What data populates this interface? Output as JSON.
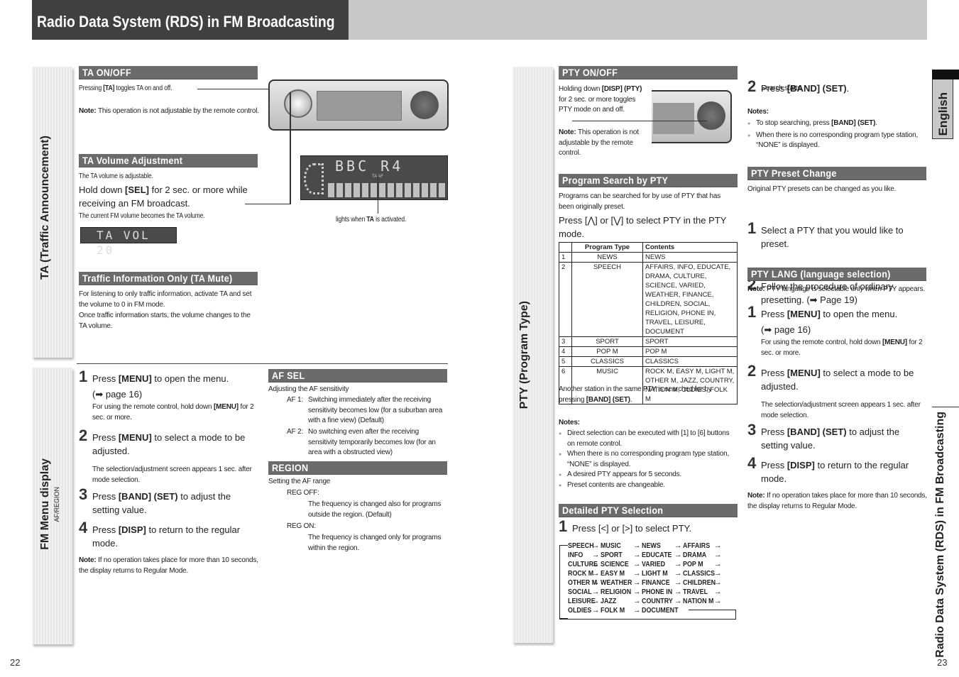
{
  "header": {
    "title": "Radio Data System (RDS) in FM Broadcasting"
  },
  "left_page": {
    "page_number": "22",
    "side_tabs": {
      "ta": "TA (Traffic Announcement)",
      "fm_menu": "FM Menu display",
      "fm_menu_sub": "AF/REGION"
    },
    "ta_on_off": {
      "heading": "TA ON/OFF",
      "text_pre": "Pressing ",
      "text_key": "[TA]",
      "text_post": " toggles TA on and off.",
      "note_label": "Note:",
      "note_text": " This operation is not adjustable by the remote control."
    },
    "ta_volume": {
      "heading": "TA Volume Adjustment",
      "intro": "The TA volume is adjustable.",
      "instr_pre": "Hold down ",
      "instr_key": "[SEL]",
      "instr_post": " for 2 sec. or more while receiving an FM broadcast.",
      "result": "The current FM volume becomes the TA volume.",
      "lcd_text": "TA VOL 20"
    },
    "display_illustration": {
      "lcd_station": "BBC R4",
      "indicators": "TA  AF",
      "caption_pre": "lights when ",
      "caption_key": "TA",
      "caption_post": " is activated."
    },
    "ta_mute": {
      "heading": "Traffic Information Only (TA Mute)",
      "p1": "For listening to only traffic information, activate TA and set the volume to 0 in FM mode.",
      "p2": "Once traffic information starts, the volume changes to the TA volume."
    },
    "fm_menu_steps": {
      "s1_num": "1",
      "s1_pre": "Press ",
      "s1_key": "[MENU]",
      "s1_post": " to open the menu.",
      "s1_ref": "(➡ page 16)",
      "s1_note_pre": "For using the remote control, hold down ",
      "s1_note_key": "[MENU]",
      "s1_note_post": " for 2 sec. or more.",
      "s2_num": "2",
      "s2_pre": "Press ",
      "s2_key": "[MENU]",
      "s2_post": " to select a mode to be adjusted.",
      "s2_note": "The selection/adjustment screen appears 1 sec. after mode selection.",
      "s3_num": "3",
      "s3_pre": "Press ",
      "s3_key": "[BAND] (SET)",
      "s3_post": " to adjust the setting value.",
      "s4_num": "4",
      "s4_pre": "Press ",
      "s4_key": "[DISP]",
      "s4_post": " to return to the regular mode.",
      "note_label": "Note:",
      "note_text": " If no operation takes place for more than 10 seconds, the display returns to Regular Mode."
    },
    "af_sel": {
      "heading": "AF SEL",
      "intro": "Adjusting the AF sensitivity",
      "af1_label": "AF 1:",
      "af1_text": "Switching immediately after the receiving sensitivity becomes low (for a suburban area with a fine view) (Default)",
      "af2_label": "AF 2:",
      "af2_text": "No switching even after the receiving sensitivity temporarily becomes low (for an area with a obstructed view)"
    },
    "region": {
      "heading": "REGION",
      "intro": "Setting the AF range",
      "off_label": "REG OFF:",
      "off_text": "The frequency is changed also for programs outside the region. (Default)",
      "on_label": "REG ON:",
      "on_text": "The frequency is changed only for programs within the region."
    }
  },
  "right_page": {
    "page_number": "23",
    "side_tab": "PTY (Program Type)",
    "language_tab": "English",
    "right_vertical_title": "Radio Data System (RDS) in FM Broadcasting",
    "pty_on_off": {
      "heading": "PTY ON/OFF",
      "text_pre": "Holding down ",
      "text_key": "[DISP] (PTY)",
      "text_post": " for 2 sec. or more toggles PTY mode on and off.",
      "note_label": "Note:",
      "note_text": " This operation is not adjustable by the remote control."
    },
    "program_search": {
      "heading": "Program Search by PTY",
      "intro": "Programs can be searched for by use of PTY that has been originally preset.",
      "instr": "Press [⋀] or [⋁] to select PTY in the PTY mode.",
      "table": {
        "headers": [
          "",
          "Program Type",
          "Contents"
        ],
        "rows": [
          [
            "1",
            "NEWS",
            "NEWS"
          ],
          [
            "2",
            "SPEECH",
            "AFFAIRS, INFO, EDUCATE, DRAMA, CULTURE, SCIENCE, VARIED, WEATHER, FINANCE, CHILDREN, SOCIAL, RELIGION, PHONE IN, TRAVEL, LEISURE, DOCUMENT"
          ],
          [
            "3",
            "SPORT",
            "SPORT"
          ],
          [
            "4",
            "POP M",
            "POP M"
          ],
          [
            "5",
            "CLASSICS",
            "CLASSICS"
          ],
          [
            "6",
            "MUSIC",
            "ROCK M, EASY M, LIGHT M, OTHER M, JAZZ, COUNTRY, NATION M, OLDIES, FOLK M"
          ]
        ]
      },
      "after_pre": "Another station in the same PTY is searched for by pressing ",
      "after_key": "[BAND] (SET)",
      "after_post": ".",
      "notes_label": "Notes:",
      "notes": [
        "Direct selection can be executed with [1] to [6] buttons on remote control.",
        "When there is no corresponding program type station, “NONE” is displayed.",
        "A desired PTY appears for 5 seconds.",
        "Preset contents are changeable."
      ]
    },
    "step2": {
      "num": "2",
      "pre": "Press ",
      "key": "[BAND] (SET)",
      "post": ".",
      "sub": "Search starts.",
      "notes_label": "Notes:",
      "note1_pre": "To stop searching, press ",
      "note1_key": "[BAND] (SET)",
      "note1_post": ".",
      "note2": "When there is no corresponding program type station, “NONE” is displayed."
    },
    "detailed": {
      "heading": "Detailed PTY Selection",
      "step_num": "1",
      "step_text": "Press [<] or [>] to select PTY.",
      "cycle": [
        [
          "SPEECH",
          "MUSIC",
          "NEWS",
          "AFFAIRS"
        ],
        [
          "INFO",
          "SPORT",
          "EDUCATE",
          "DRAMA"
        ],
        [
          "CULTURE",
          "SCIENCE",
          "VARIED",
          "POP M"
        ],
        [
          "ROCK M",
          "EASY M",
          "LIGHT M",
          "CLASSICS"
        ],
        [
          "OTHER M",
          "WEATHER",
          "FINANCE",
          "CHILDREN"
        ],
        [
          "SOCIAL",
          "RELIGION",
          "PHONE IN",
          "TRAVEL"
        ],
        [
          "LEISURE",
          "JAZZ",
          "COUNTRY",
          "NATION M"
        ],
        [
          "OLDIES",
          "FOLK M",
          "DOCUMENT",
          ""
        ]
      ],
      "arrow": "→"
    },
    "preset_change": {
      "heading": "PTY Preset Change",
      "intro": "Original PTY presets can be changed as you like.",
      "s1_num": "1",
      "s1": "Select a PTY that you would like to preset.",
      "s2_num": "2",
      "s2": "Follow the procedure of ordinary presetting. (➡ Page 19)"
    },
    "pty_lang": {
      "heading": "PTY LANG (language selection)",
      "note_label": "Note:",
      "note_text": " PTY language is selectable only when PTY appears.",
      "s1_num": "1",
      "s1_pre": "Press ",
      "s1_key": "[MENU]",
      "s1_post": " to open the menu.",
      "s1_ref": "(➡ page 16)",
      "s1_note_pre": "For using the remote control, hold down ",
      "s1_note_key": "[MENU]",
      "s1_note_post": " for 2 sec. or more.",
      "s2_num": "2",
      "s2_pre": "Press ",
      "s2_key": "[MENU]",
      "s2_post": " to select a mode to be adjusted.",
      "s2_note": "The selection/adjustment screen appears 1 sec. after mode selection.",
      "s3_num": "3",
      "s3_pre": "Press ",
      "s3_key": "[BAND] (SET)",
      "s3_post": " to adjust the setting value.",
      "s4_num": "4",
      "s4_pre": "Press ",
      "s4_key": "[DISP]",
      "s4_post": " to return to the regular mode.",
      "end_note_label": "Note:",
      "end_note_text": " If no operation takes place for more than 10 seconds, the display returns to Regular Mode."
    }
  }
}
